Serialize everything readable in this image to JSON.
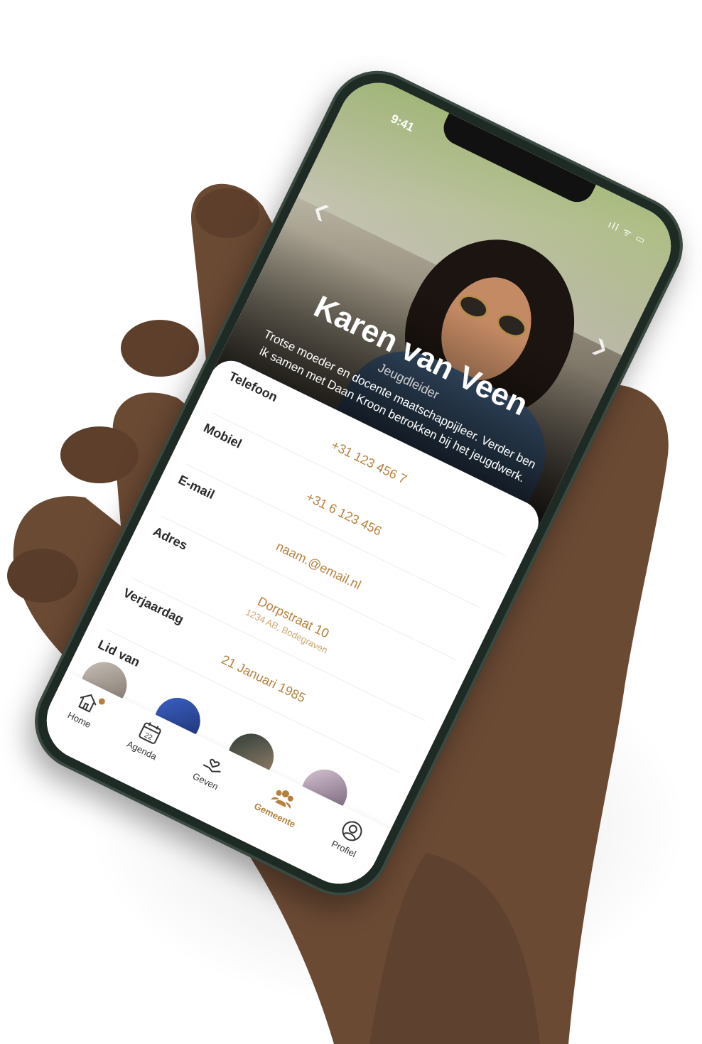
{
  "status": {
    "time": "9:41",
    "signal": "ıll ᯤ ▭"
  },
  "profile": {
    "name": "Karen van Veen",
    "role": "Jeugdleider",
    "bio": "Trotse moeder en docente maatschappijleer. Verder ben ik samen met Daan Kroon betrokken bij het jeugdwerk."
  },
  "details": [
    {
      "label": "Telefoon",
      "value": "+31 123 456 7"
    },
    {
      "label": "Mobiel",
      "value": "+31 6 123 456"
    },
    {
      "label": "E-mail",
      "value": "naam.@email.nl"
    },
    {
      "label": "Adres",
      "value": "Dorpstraat 10",
      "sub": "1234 AB, Bodegraven"
    },
    {
      "label": "Verjaardag",
      "value": "21 Januari 1985"
    }
  ],
  "member_of_label": "Lid van",
  "tabs": {
    "home": "Home",
    "agenda": "Agenda",
    "agenda_day": "22",
    "geven": "Geven",
    "gemeente": "Gemeente",
    "profiel": "Profiel"
  },
  "colors": {
    "accent": "#b5803d",
    "phone_frame": "#1e2a24",
    "skin": "#6b4a34"
  }
}
